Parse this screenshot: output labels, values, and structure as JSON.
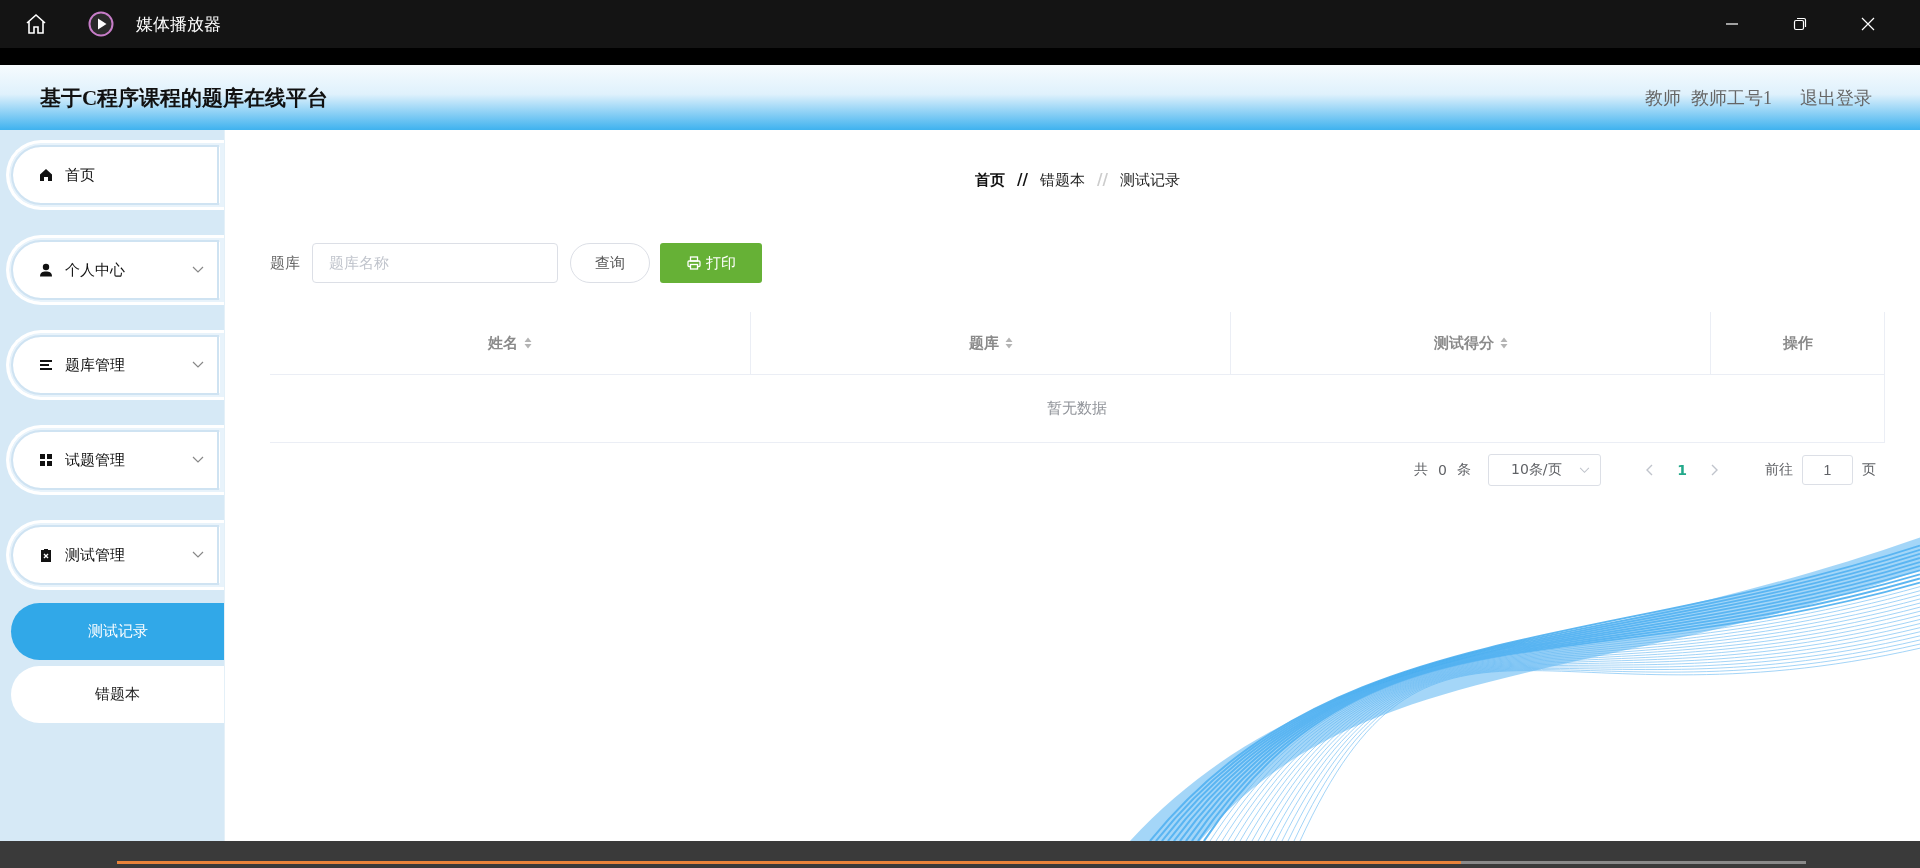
{
  "window": {
    "title": "媒体播放器"
  },
  "header": {
    "title": "基于C程序课程的题库在线平台",
    "role": "教师",
    "user": "教师工号1",
    "logout": "退出登录"
  },
  "sidebar": {
    "items": [
      {
        "label": "首页",
        "kind": "link"
      },
      {
        "label": "个人中心",
        "kind": "menu"
      },
      {
        "label": "题库管理",
        "kind": "menu"
      },
      {
        "label": "试题管理",
        "kind": "menu"
      },
      {
        "label": "测试管理",
        "kind": "menu",
        "children": [
          {
            "label": "测试记录",
            "selected": true
          },
          {
            "label": "错题本",
            "selected": false
          }
        ]
      }
    ]
  },
  "breadcrumb": [
    {
      "kind": "crumb",
      "text": "首页"
    },
    {
      "kind": "separator",
      "text": "//"
    },
    {
      "kind": "crumb",
      "text": "错题本"
    },
    {
      "kind": "separator",
      "text": "//"
    },
    {
      "kind": "crumb",
      "text": "测试记录"
    }
  ],
  "search": {
    "label": "题库",
    "placeholder": "题库名称",
    "query_button": "查询",
    "print_button": "打印"
  },
  "table": {
    "columns": [
      {
        "label": "姓名",
        "sortable": true
      },
      {
        "label": "题库",
        "sortable": true
      },
      {
        "label": "测试得分",
        "sortable": true
      },
      {
        "label": "操作",
        "sortable": false
      }
    ],
    "empty_text": "暂无数据"
  },
  "pagination": {
    "total_prefix": "共",
    "total": "0",
    "total_suffix": "条",
    "page_size": "10条/页",
    "pages": [
      {
        "label": "1",
        "selected": true
      }
    ],
    "goto_label": "前往",
    "goto_value": "1",
    "goto_suffix": "页"
  },
  "player": {
    "level": 0.796
  }
}
